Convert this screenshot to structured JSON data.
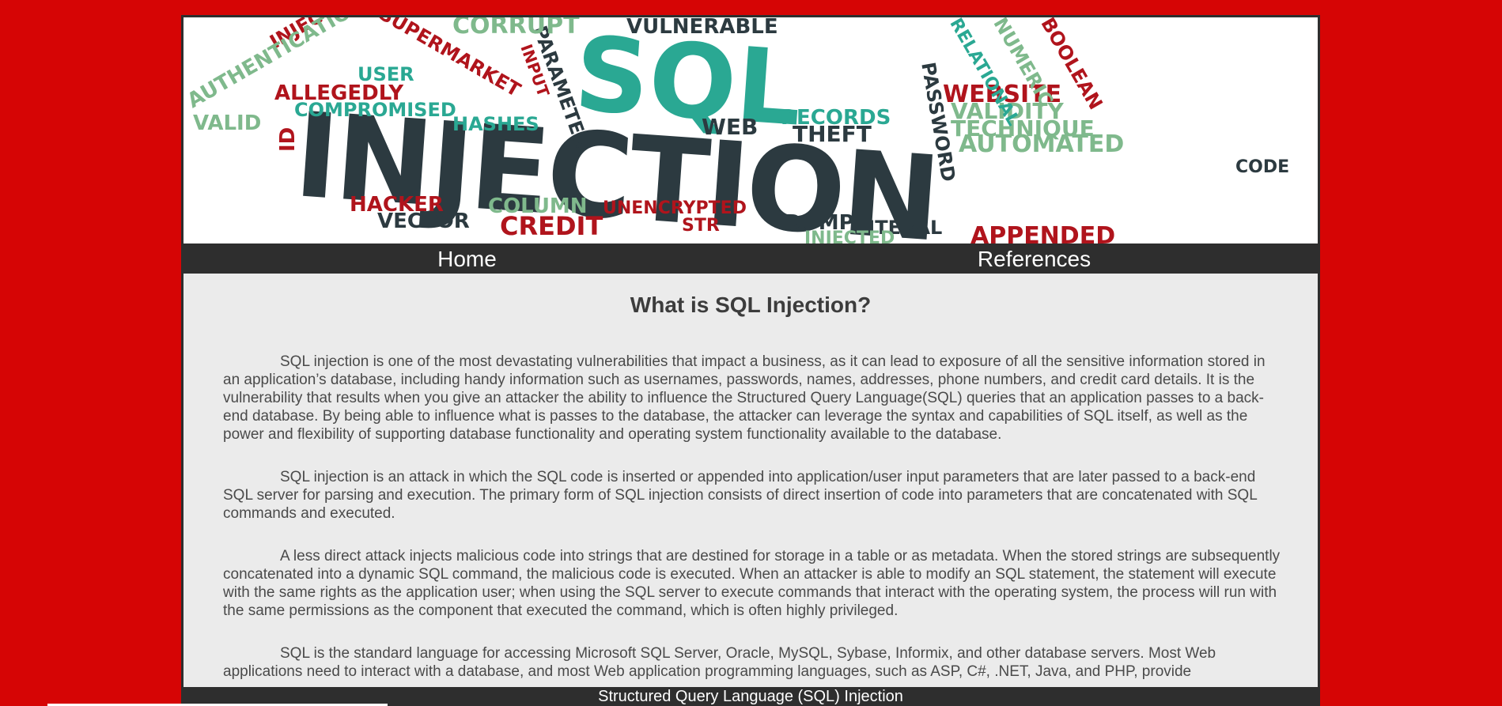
{
  "banner": {
    "title_big": "INJECTION",
    "title_top": "SQL",
    "words": [
      "VULNERABLE",
      "PARAMETER",
      "INPUT",
      "USER",
      "INJECT",
      "SUPERMARKET",
      "AUTHENTICATION",
      "ALLEGEDLY",
      "COMPROMISED",
      "HASHES",
      "VALID",
      "ID",
      "WEB",
      "THEFT",
      "RECORDS",
      "PASSWORD",
      "WEBSITE",
      "VALIDITY",
      "TECHNIQUE",
      "AUTOMATED",
      "CODE",
      "HACKER",
      "COLUMN",
      "UNENCRYPTED",
      "VECTOR",
      "CREDIT",
      "STR",
      "DUMP",
      "LITERAL",
      "APPENDED",
      "INJECTED",
      "NUMERIC",
      "BOOLEAN",
      "CORRUPT",
      "RELATIONAL"
    ]
  },
  "nav": {
    "home": "Home",
    "references": "References"
  },
  "main": {
    "title": "What is SQL Injection?",
    "paragraphs": [
      "SQL injection is one of the most devastating vulnerabilities that impact a business, as it can lead to exposure of all the sensitive information stored in an application’s database, including handy information such as usernames, passwords, names, addresses, phone numbers, and credit card details. It is the vulnerability that results when you give an attacker the ability to influence the Structured Query Language(SQL) queries that an application passes to a back-end database. By being able to influence what is passes to the database, the attacker can leverage the syntax and capabilities of SQL itself, as well as the power and flexibility of supporting database functionality and operating system functionality available to the database.",
      "SQL injection is an attack in which the SQL code is inserted or appended into application/user input parameters that are later passed to a back-end SQL server for parsing and execution. The primary form of SQL injection consists of direct insertion of code into parameters that are concatenated with SQL commands and executed.",
      "A less direct attack injects malicious code into strings that are destined for storage in a table or as metadata. When the stored strings are subsequently concatenated into a dynamic SQL command, the malicious code is executed. When an attacker is able to modify an SQL statement, the statement will execute with the same rights as the application user; when using the SQL server to execute commands that interact with the operating system, the process will run with the same permissions as the component that executed the command, which is often highly privileged.",
      "SQL is the standard language for accessing Microsoft SQL Server, Oracle, MySQL, Sybase, Informix, and other database servers. Most Web applications need to interact with a database, and most Web application programming languages, such as ASP, C#, .NET, Java, and PHP, provide"
    ]
  },
  "footer": {
    "text": "Structured Query Language (SQL) Injection"
  },
  "colors": {
    "background": "#d60505",
    "frame": "#2e2e2e",
    "teal": "#2aa893",
    "dark": "#2c3a40",
    "red": "#b0141c",
    "green": "#7fb98c"
  }
}
